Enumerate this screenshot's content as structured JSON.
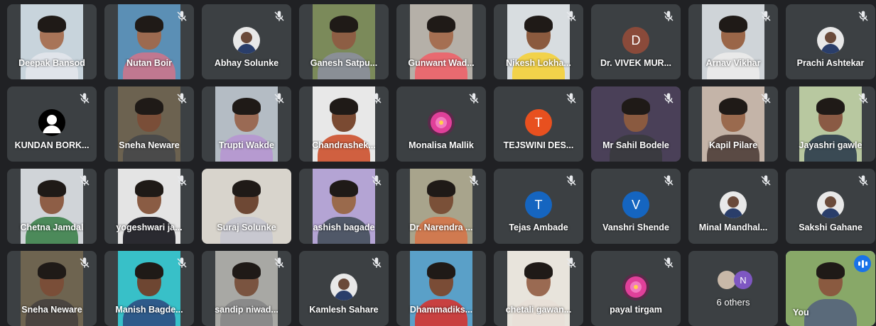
{
  "colors": {
    "tile_bg": "#3c4043",
    "page_bg": "#202124",
    "avatar_D": "#8a4a3a",
    "avatar_T": "#e8501f",
    "avatar_T_blue": "#1565c0",
    "avatar_V": "#1565c0",
    "avatar_N": "#7e57c2",
    "self_border": "#8ab4f8",
    "speaking": "#1a73e8"
  },
  "participants": [
    {
      "name": "Deepak Bansod",
      "type": "cam",
      "muted": false,
      "skin": "#a87458",
      "shirt": "#e0e4ea",
      "bg": "#c8d4dc"
    },
    {
      "name": "Nutan Boir",
      "type": "cam",
      "muted": true,
      "skin": "#9c6a50",
      "shirt": "#c07890",
      "bg": "#5b8fb5"
    },
    {
      "name": "Abhay Solunke",
      "type": "photo",
      "muted": true,
      "icon": "profile-photo-icon"
    },
    {
      "name": "Ganesh Satpu...",
      "type": "cam",
      "muted": false,
      "skin": "#8d5e44",
      "shirt": "#8a8f96",
      "bg": "#7b8a5a"
    },
    {
      "name": "Gunwant Wad...",
      "type": "cam",
      "muted": false,
      "skin": "#a56f52",
      "shirt": "#e86a70",
      "bg": "#b5b0a8"
    },
    {
      "name": "Nikesh Lokha...",
      "type": "cam",
      "muted": true,
      "skin": "#8b5a3e",
      "shirt": "#f2d24a",
      "bg": "#d8dde0"
    },
    {
      "name": "Dr. VIVEK MUR...",
      "type": "letter",
      "muted": true,
      "letter": "D",
      "color": "#8a4a3a"
    },
    {
      "name": "Arnav Vikhar",
      "type": "cam",
      "muted": true,
      "skin": "#9a6648",
      "shirt": "#e9e9e9",
      "bg": "#cfd4d8"
    },
    {
      "name": "Prachi Ashtekar",
      "type": "photo",
      "muted": true,
      "icon": "profile-photo-icon"
    },
    {
      "name": "KUNDAN BORK...",
      "type": "default",
      "muted": true,
      "icon": "default-user-icon"
    },
    {
      "name": "Sneha Neware",
      "type": "cam",
      "muted": true,
      "skin": "#7a4e38",
      "shirt": "#4a4a4a",
      "bg": "#6c6250"
    },
    {
      "name": "Trupti Wakde",
      "type": "cam",
      "muted": true,
      "skin": "#9a6a54",
      "shirt": "#b69ad0",
      "bg": "#b4bcc4"
    },
    {
      "name": "Chandrashek...",
      "type": "cam",
      "muted": true,
      "skin": "#7a4a32",
      "shirt": "#d06040",
      "bg": "#e8e8e8"
    },
    {
      "name": "Monalisa Mallik",
      "type": "photo",
      "muted": true,
      "icon": "flower-photo-icon"
    },
    {
      "name": "TEJSWINI DES...",
      "type": "letter",
      "muted": true,
      "letter": "T",
      "color": "#e8501f"
    },
    {
      "name": "Mr Sahil Bodele",
      "type": "cam",
      "muted": true,
      "skin": "#8a5a40",
      "shirt": "#3a3a40",
      "bg": "#4a4058",
      "full": true
    },
    {
      "name": "Kapil Pilare",
      "type": "cam",
      "muted": true,
      "skin": "#9a6a4e",
      "shirt": "#5a4a44",
      "bg": "#c4b4a8"
    },
    {
      "name": "Jayashri gawle",
      "type": "cam",
      "muted": true,
      "skin": "#8a5a44",
      "shirt": "#3a4a54",
      "bg": "#b8c8a0"
    },
    {
      "name": "Chetna Jamdal",
      "type": "cam",
      "muted": true,
      "skin": "#8e5e46",
      "shirt": "#4c8a5a",
      "bg": "#d0d4d8"
    },
    {
      "name": "yogeshwari ja...",
      "type": "cam",
      "muted": true,
      "skin": "#8a5c44",
      "shirt": "#2a2a30",
      "bg": "#e4e4e4"
    },
    {
      "name": "Suraj Solunke",
      "type": "cam",
      "muted": false,
      "skin": "#6e4834",
      "shirt": "#c8c8d0",
      "bg": "#d8d4cc",
      "full": true
    },
    {
      "name": "ashish bagade",
      "type": "cam",
      "muted": true,
      "skin": "#9a6a4c",
      "shirt": "#505868",
      "bg": "#b4a4d4"
    },
    {
      "name": "Dr. Narendra ...",
      "type": "cam",
      "muted": true,
      "skin": "#7a5038",
      "shirt": "#d07a50",
      "bg": "#a8a48c"
    },
    {
      "name": "Tejas Ambade",
      "type": "letter",
      "muted": true,
      "letter": "T",
      "color": "#1565c0"
    },
    {
      "name": "Vanshri Shende",
      "type": "letter",
      "muted": true,
      "letter": "V",
      "color": "#1565c0"
    },
    {
      "name": "Minal Mandhal...",
      "type": "photo",
      "muted": true,
      "icon": "profile-photo-icon"
    },
    {
      "name": "Sakshi Gahane",
      "type": "photo",
      "muted": true,
      "icon": "profile-photo-icon"
    },
    {
      "name": "Sneha Neware",
      "type": "cam",
      "muted": true,
      "skin": "#7a4e38",
      "shirt": "#4a4440",
      "bg": "#6e6450"
    },
    {
      "name": "Manish Bagde...",
      "type": "cam",
      "muted": true,
      "skin": "#6e4632",
      "shirt": "#2e5a8a",
      "bg": "#38c0c8"
    },
    {
      "name": "sandip niwad...",
      "type": "cam",
      "muted": true,
      "skin": "#7a5440",
      "shirt": "#8a8a8a",
      "bg": "#a8a8a4"
    },
    {
      "name": "Kamlesh Sahare",
      "type": "photo",
      "muted": true,
      "icon": "profile-photo-icon"
    },
    {
      "name": "Dhammadiks...",
      "type": "cam",
      "muted": false,
      "skin": "#7a4c36",
      "shirt": "#c84040",
      "bg": "#5aa0c8"
    },
    {
      "name": "chetali gawan...",
      "type": "cam",
      "muted": true,
      "skin": "#9a6a52",
      "shirt": "#e8e0d8",
      "bg": "#e8e4dc"
    },
    {
      "name": "payal tirgam",
      "type": "photo",
      "muted": true,
      "icon": "flower-photo-icon"
    },
    {
      "name": "6 others",
      "type": "others",
      "muted": false,
      "letter": "N"
    },
    {
      "name": "You",
      "type": "self",
      "muted": false,
      "skin": "#8a5a40",
      "shirt": "#5a6a7a",
      "bg": "#88a868"
    }
  ]
}
